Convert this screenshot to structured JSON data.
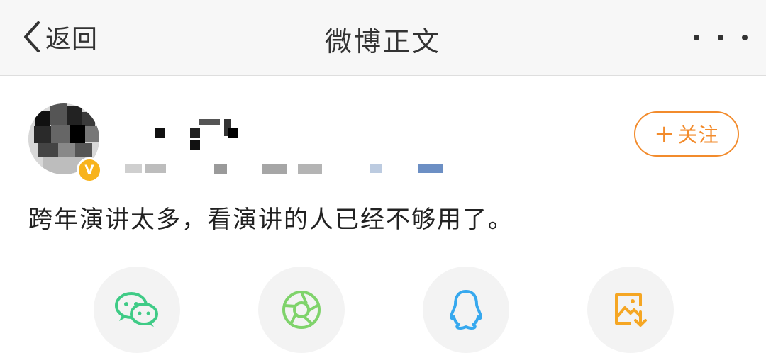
{
  "header": {
    "back_label": "返回",
    "title": "微博正文",
    "more_icon": "more-dots-icon"
  },
  "post": {
    "follow_label": "关注",
    "follow_icon": "plus-icon",
    "verified_icon": "verified-v-badge",
    "text": "跨年演讲太多，看演讲的人已经不够用了。"
  },
  "share": {
    "items": [
      {
        "icon": "wechat-icon",
        "color": "#3fcb86"
      },
      {
        "icon": "moments-aperture-icon",
        "color": "#7fd36b"
      },
      {
        "icon": "qq-penguin-icon",
        "color": "#36a8ee"
      },
      {
        "icon": "save-image-icon",
        "color": "#f5a623"
      }
    ]
  },
  "colors": {
    "accent": "#f28b2c",
    "verified": "#f8b31c",
    "header_bg": "#f7f7f7"
  }
}
